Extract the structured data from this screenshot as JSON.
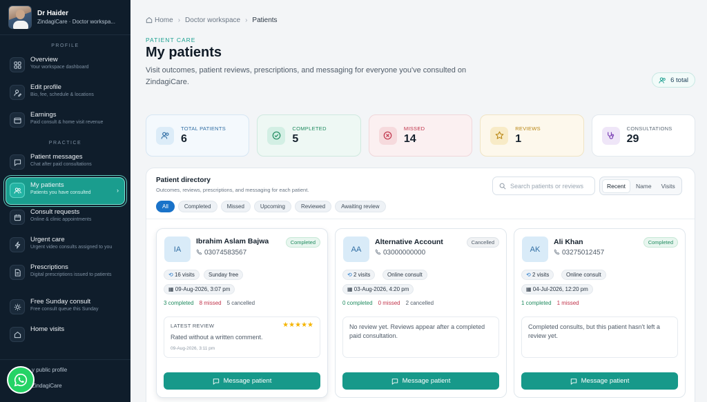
{
  "profile": {
    "name": "Dr Haider",
    "subtitle": "ZindagiCare · Doctor workspa..."
  },
  "sidebar": {
    "section_profile": "PROFILE",
    "section_practice": "PRACTICE",
    "profile_items": [
      {
        "title": "Overview",
        "sub": "Your workspace dashboard",
        "icon": "grid-icon"
      },
      {
        "title": "Edit profile",
        "sub": "Bio, fee, schedule & locations",
        "icon": "user-edit-icon"
      },
      {
        "title": "Earnings",
        "sub": "Paid consult & home visit revenue",
        "icon": "wallet-icon"
      }
    ],
    "practice_items": [
      {
        "title": "Patient messages",
        "sub": "Chat after paid consultations",
        "icon": "chat-icon"
      },
      {
        "title": "My patients",
        "sub": "Patients you have consulted",
        "icon": "users-icon",
        "active": true
      },
      {
        "title": "Consult requests",
        "sub": "Online & clinic appointments",
        "icon": "calendar-icon"
      },
      {
        "title": "Urgent care",
        "sub": "Urgent video consults assigned to you",
        "icon": "bolt-icon"
      },
      {
        "title": "Prescriptions",
        "sub": "Digital prescriptions issued to patients",
        "icon": "document-icon"
      },
      {
        "title": "Free Sunday consult",
        "sub": "Free consult queue this Sunday",
        "icon": "sun-icon"
      },
      {
        "title": "Home visits",
        "sub": "",
        "icon": "home-icon"
      }
    ],
    "footer": {
      "public_profile": "y public profile",
      "brand": "ZindagiCare"
    }
  },
  "breadcrumb": {
    "home": "Home",
    "workspace": "Doctor workspace",
    "current": "Patients"
  },
  "header": {
    "eyebrow": "PATIENT CARE",
    "title": "My patients",
    "description": "Visit outcomes, patient reviews, prescriptions, and messaging for everyone you've consulted on ZindagiCare.",
    "total_badge": "6 total"
  },
  "stats": [
    {
      "label": "TOTAL PATIENTS",
      "value": "6"
    },
    {
      "label": "COMPLETED",
      "value": "5"
    },
    {
      "label": "MISSED",
      "value": "14"
    },
    {
      "label": "REVIEWS",
      "value": "1"
    },
    {
      "label": "CONSULTATIONS",
      "value": "29"
    }
  ],
  "directory": {
    "title": "Patient directory",
    "subtitle": "Outcomes, reviews, prescriptions, and messaging for each patient.",
    "search_placeholder": "Search patients or reviews",
    "filters": [
      "All",
      "Completed",
      "Missed",
      "Upcoming",
      "Reviewed",
      "Awaiting review"
    ],
    "sort": [
      "Recent",
      "Name",
      "Visits"
    ]
  },
  "patients": [
    {
      "initials": "IA",
      "name": "Ibrahim Aslam Bajwa",
      "phone": "03074583567",
      "status": "Completed",
      "visits": "16 visits",
      "type": "Sunday free",
      "date": "09-Aug-2026, 3:07 pm",
      "completed": "3 completed",
      "missed": "8 missed",
      "cancelled": "5 cancelled",
      "review_label": "LATEST REVIEW",
      "review_text": "Rated without a written comment.",
      "review_date": "09-Aug-2026, 3:11 pm",
      "button": "Message patient"
    },
    {
      "initials": "AA",
      "name": "Alternative Account",
      "phone": "03000000000",
      "status": "Cancelled",
      "visits": "2 visits",
      "type": "Online consult",
      "date": "03-Aug-2026, 4:20 pm",
      "completed": "0 completed",
      "missed": "0 missed",
      "cancelled": "2 cancelled",
      "empty_text": "No review yet. Reviews appear after a completed paid consultation.",
      "button": "Message patient"
    },
    {
      "initials": "AK",
      "name": "Ali Khan",
      "phone": "03275012457",
      "status": "Completed",
      "visits": "2 visits",
      "type": "Online consult",
      "date": "04-Jul-2026, 12:20 pm",
      "completed": "1 completed",
      "missed": "1 missed",
      "empty_text": "Completed consults, but this patient hasn't left a review yet.",
      "button": "Message patient"
    }
  ],
  "colors": {
    "accent": "#17998a",
    "primary": "#1a73c9",
    "sidebar_bg": "#0f1d2b",
    "whatsapp": "#25d366"
  }
}
